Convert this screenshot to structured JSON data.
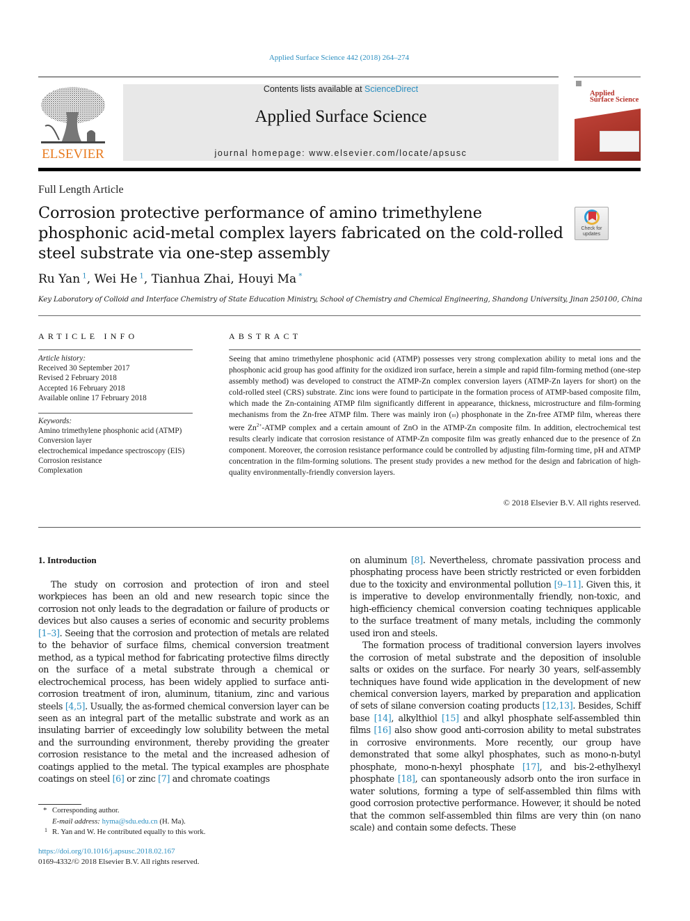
{
  "header": {
    "journal_ref": "Applied Surface Science 442 (2018) 264–274",
    "contents_prefix": "Contents lists available at ",
    "contents_link": "ScienceDirect",
    "journal_title": "Applied Surface Science",
    "homepage_line": "journal homepage: www.elsevier.com/locate/apsusc",
    "publisher_logo_text": "ELSEVIER",
    "cover_title_line1": "Applied",
    "cover_title_line2": "Surface Science",
    "colors": {
      "link": "#2a8ec0",
      "elsevier_orange": "#e87a1e",
      "cover_red": "#b5322a",
      "masthead_bg": "#e8e8e8"
    }
  },
  "article": {
    "type": "Full Length Article",
    "title": "Corrosion protective performance of amino trimethylene phosphonic acid-metal complex layers fabricated on the cold-rolled steel substrate via one-step assembly",
    "check_updates_line1": "Check for",
    "check_updates_line2": "updates",
    "authors": [
      {
        "name": "Ru Yan",
        "mark": "1"
      },
      {
        "name": "Wei He",
        "mark": "1"
      },
      {
        "name": "Tianhua Zhai",
        "mark": ""
      },
      {
        "name": "Houyi Ma",
        "mark": "*"
      }
    ],
    "affiliation": "Key Laboratory of Colloid and Interface Chemistry of State Education Ministry, School of Chemistry and Chemical Engineering, Shandong University, Jinan 250100, China"
  },
  "article_info": {
    "label": "ARTICLE INFO",
    "history_head": "Article history:",
    "history": [
      "Received 30 September 2017",
      "Revised 2 February 2018",
      "Accepted 16 February 2018",
      "Available online 17 February 2018"
    ],
    "keywords_head": "Keywords:",
    "keywords": [
      "Amino trimethylene phosphonic acid (ATMP)",
      "Conversion layer",
      "electrochemical impedance spectroscopy (EIS)",
      "Corrosion resistance",
      "Complexation"
    ]
  },
  "abstract": {
    "label": "ABSTRACT",
    "part1": "Seeing that amino trimethylene phosphonic acid (ATMP) possesses very strong complexation ability to metal ions and the phosphonic acid group has good affinity for the oxidized iron surface, herein a simple and rapid film-forming method (one-step assembly method) was developed to construct the ATMP-Zn complex conversion layers (ATMP-Zn layers for short) on the cold-rolled steel (CRS) substrate. Zinc ions were found to participate in the formation process of ATMP-based composite film, which made the Zn-containing ATMP film significantly different in appearance, thickness, microstructure and film-forming mechanisms from the Zn-free ATMP film. There was mainly iron (",
    "roman": "iii",
    "part2": ") phosphonate in the Zn-free ATMP film, whereas there were Zn",
    "sup": "2+",
    "part3": "-ATMP complex and a certain amount of ZnO in the ATMP-Zn composite film. In addition, electrochemical test results clearly indicate that corrosion resistance of ATMP-Zn composite film was greatly enhanced due to the presence of Zn component. Moreover, the corrosion resistance performance could be controlled by adjusting film-forming time, pH and ATMP concentration in the film-forming solutions. The present study provides a new method for the design and fabrication of high-quality environmentally-friendly conversion layers.",
    "copyright": "© 2018 Elsevier B.V. All rights reserved."
  },
  "introduction": {
    "heading": "1. Introduction",
    "left_p1": [
      {
        "t": "The study on corrosion and protection of iron and steel workpieces has been an old and new research topic since the corrosion not only leads to the degradation or failure of products or devices but also causes a series of economic and security problems "
      },
      {
        "ref": "[1–3]"
      },
      {
        "t": ". Seeing that the corrosion and protection of metals are related to the behavior of surface films, chemical conversion treatment method, as a typical method for fabricating protective films directly on the surface of a metal substrate through a chemical or electrochemical process, has been widely applied to surface anti-corrosion treatment of iron, aluminum, titanium, zinc and various steels "
      },
      {
        "ref": "[4,5]"
      },
      {
        "t": ". Usually, the as-formed chemical conversion layer can be seen as an integral part of the metallic substrate and work as an insulating barrier of exceedingly low solubility between the metal and the surrounding environment, thereby providing the greater corrosion resistance to the metal and the increased adhesion of coatings applied to the metal. The typical examples are phosphate coatings on steel "
      },
      {
        "ref": "[6]"
      },
      {
        "t": " or zinc "
      },
      {
        "ref": "[7]"
      },
      {
        "t": " and chromate coatings"
      }
    ],
    "right_p1": [
      {
        "t": "on aluminum "
      },
      {
        "ref": "[8]"
      },
      {
        "t": ". Nevertheless, chromate passivation process and phosphating process have been strictly restricted or even forbidden due to the toxicity and environmental pollution "
      },
      {
        "ref": "[9–11]"
      },
      {
        "t": ". Given this, it is imperative to develop environmentally friendly, non-toxic, and high-efficiency chemical conversion coating techniques applicable to the surface treatment of many metals, including the commonly used iron and steels."
      }
    ],
    "right_p2": [
      {
        "t": "The formation process of traditional conversion layers involves the corrosion of metal substrate and the deposition of insoluble salts or oxides on the surface. For nearly 30 years, self-assembly techniques have found wide application in the development of new chemical conversion layers, marked by preparation and application of sets of silane conversion coating products "
      },
      {
        "ref": "[12,13]"
      },
      {
        "t": ". Besides, Schiff base "
      },
      {
        "ref": "[14]"
      },
      {
        "t": ", alkylthiol "
      },
      {
        "ref": "[15]"
      },
      {
        "t": " and alkyl phosphate self-assembled thin films "
      },
      {
        "ref": "[16]"
      },
      {
        "t": " also show good anti-corrosion ability to metal substrates in corrosive environments. More recently, our group have demonstrated that some alkyl phosphates, such as mono-n-butyl phosphate, mono-n-hexyl phosphate "
      },
      {
        "ref": "[17]"
      },
      {
        "t": ", and bis-2-ethylhexyl phosphate "
      },
      {
        "ref": "[18]"
      },
      {
        "t": ", can spontaneously adsorb onto the iron surface in water solutions, forming a type of self-assembled thin films with good corrosion protective performance. However, it should be noted that the common self-assembled thin films are very thin (on nano scale) and contain some defects. These"
      }
    ]
  },
  "footnotes": {
    "corresponding_mark": "*",
    "corresponding": "Corresponding author.",
    "email_label": "E-mail address:",
    "email": "hyma@sdu.edu.cn",
    "email_suffix": " (H. Ma).",
    "equal_mark": "1",
    "equal": "R. Yan and W. He contributed equally to this work.",
    "doi": "https://doi.org/10.1016/j.apsusc.2018.02.167",
    "issn_line": "0169-4332/© 2018 Elsevier B.V. All rights reserved."
  }
}
